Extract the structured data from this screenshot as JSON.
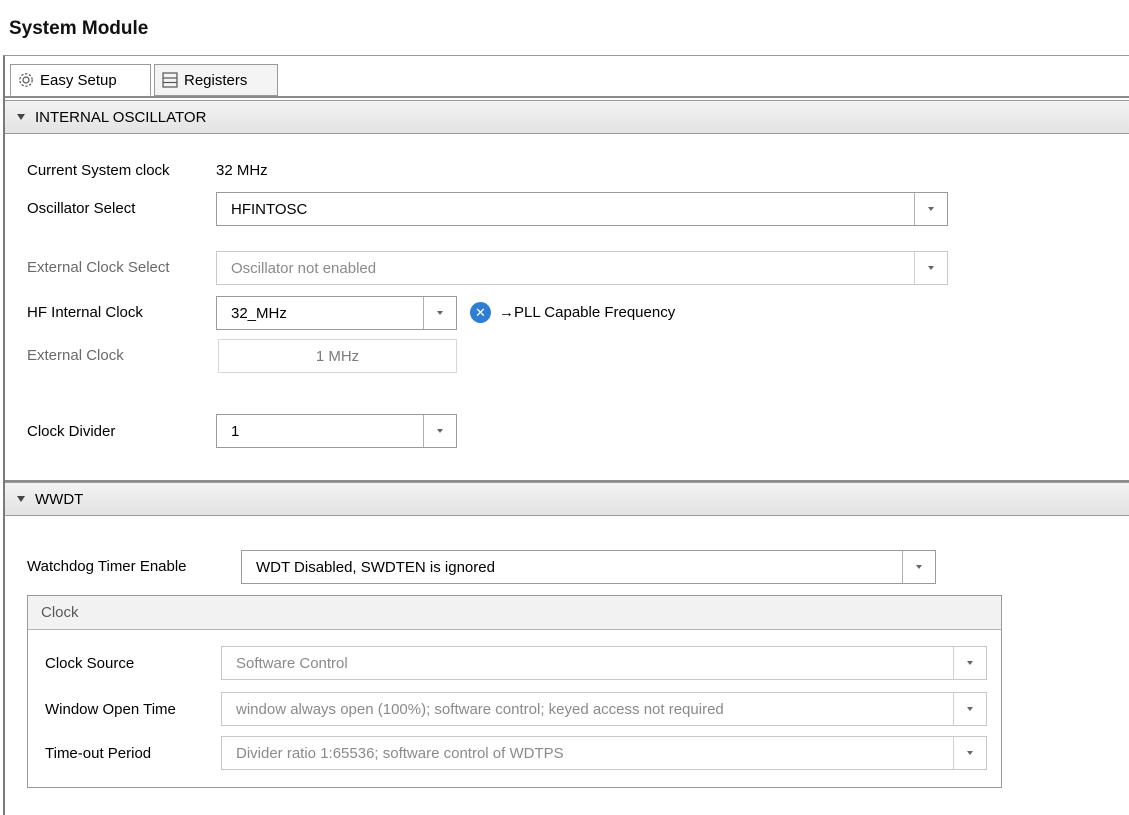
{
  "title": "System Module",
  "tabs": [
    {
      "label": "Easy Setup",
      "icon": "gear-icon",
      "active": true
    },
    {
      "label": "Registers",
      "icon": "list-icon",
      "active": false
    }
  ],
  "internal_oscillator": {
    "header": "INTERNAL OSCILLATOR",
    "current_clock_label": "Current System clock",
    "current_clock_value": "32 MHz",
    "osc_select_label": "Oscillator Select",
    "osc_select_value": "HFINTOSC",
    "ext_clock_select_label": "External Clock Select",
    "ext_clock_select_value": "Oscillator not enabled",
    "hf_internal_label": "HF Internal Clock",
    "hf_internal_value": "32_MHz",
    "pll_hint": "→PLL Capable Frequency",
    "pll_hint_icon": "close-circle-icon",
    "ext_clock_label": "External Clock",
    "ext_clock_value": "1 MHz",
    "clock_divider_label": "Clock Divider",
    "clock_divider_value": "1"
  },
  "wwdt": {
    "header": "WWDT",
    "wdt_enable_label": "Watchdog Timer Enable",
    "wdt_enable_value": "WDT Disabled, SWDTEN is ignored",
    "clock_panel": {
      "header": "Clock",
      "clock_source_label": "Clock Source",
      "clock_source_value": "Software Control",
      "window_open_label": "Window Open Time",
      "window_open_value": "window always open (100%); software control; keyed access not required",
      "timeout_label": "Time-out Period",
      "timeout_value": "Divider ratio 1:65536; software control of WDTPS"
    }
  },
  "colors": {
    "hint_icon": "#2e7fd3",
    "section_header_bg": "#e8e8e8"
  }
}
